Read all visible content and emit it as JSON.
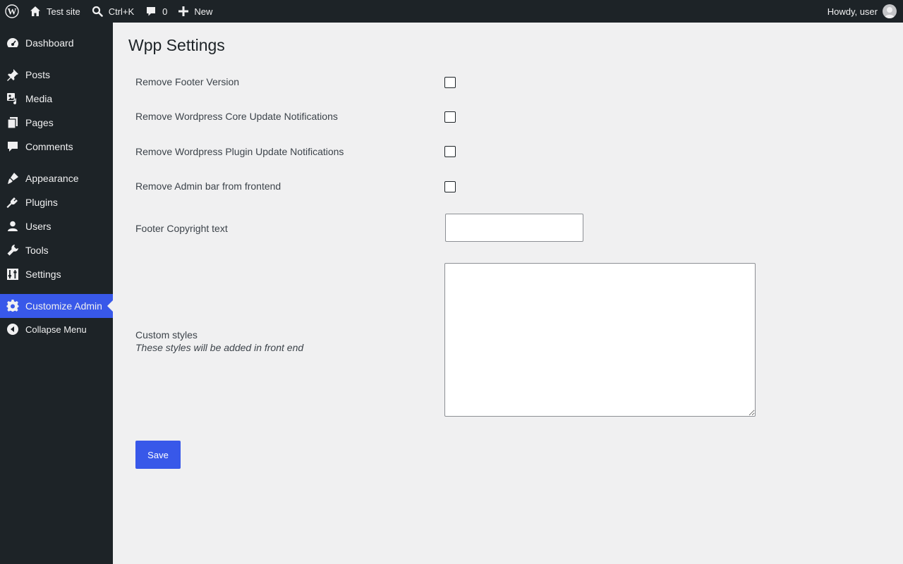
{
  "adminbar": {
    "site_name": "Test site",
    "search_shortcut": "Ctrl+K",
    "comments_count": "0",
    "new_label": "New",
    "greeting": "Howdy, user"
  },
  "sidebar": {
    "items": [
      {
        "label": "Dashboard",
        "icon": "dashboard-icon"
      },
      {
        "label": "Posts",
        "icon": "pin-icon"
      },
      {
        "label": "Media",
        "icon": "media-icon"
      },
      {
        "label": "Pages",
        "icon": "pages-icon"
      },
      {
        "label": "Comments",
        "icon": "comment-icon"
      },
      {
        "label": "Appearance",
        "icon": "paintbrush-icon"
      },
      {
        "label": "Plugins",
        "icon": "plug-icon"
      },
      {
        "label": "Users",
        "icon": "user-icon"
      },
      {
        "label": "Tools",
        "icon": "wrench-icon"
      },
      {
        "label": "Settings",
        "icon": "settings-sliders-icon"
      },
      {
        "label": "Customize Admin",
        "icon": "gear-icon",
        "current": true
      },
      {
        "label": "Collapse Menu",
        "icon": "collapse-icon"
      }
    ],
    "accent_color": "#3858e9"
  },
  "page": {
    "title": "Wpp Settings",
    "fields": {
      "remove_footer_version": {
        "label": "Remove Footer Version",
        "checked": false
      },
      "remove_core_updates": {
        "label": "Remove Wordpress Core Update Notifications",
        "checked": false
      },
      "remove_plugin_updates": {
        "label": "Remove Wordpress Plugin Update Notifications",
        "checked": false
      },
      "remove_admin_bar": {
        "label": "Remove Admin bar from frontend",
        "checked": false
      },
      "footer_copyright": {
        "label": "Footer Copyright text",
        "value": ""
      },
      "custom_styles": {
        "label": "Custom styles",
        "description": "These styles will be added in front end",
        "value": ""
      }
    },
    "save_label": "Save"
  }
}
